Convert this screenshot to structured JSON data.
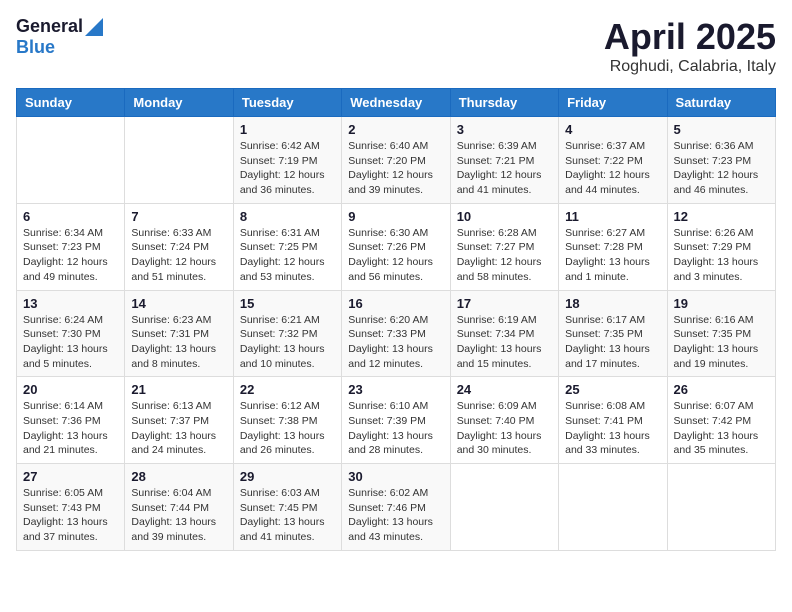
{
  "header": {
    "logo_general": "General",
    "logo_blue": "Blue",
    "month_title": "April 2025",
    "location": "Roghudi, Calabria, Italy"
  },
  "weekdays": [
    "Sunday",
    "Monday",
    "Tuesday",
    "Wednesday",
    "Thursday",
    "Friday",
    "Saturday"
  ],
  "weeks": [
    [
      {
        "day": "",
        "info": ""
      },
      {
        "day": "",
        "info": ""
      },
      {
        "day": "1",
        "info": "Sunrise: 6:42 AM\nSunset: 7:19 PM\nDaylight: 12 hours\nand 36 minutes."
      },
      {
        "day": "2",
        "info": "Sunrise: 6:40 AM\nSunset: 7:20 PM\nDaylight: 12 hours\nand 39 minutes."
      },
      {
        "day": "3",
        "info": "Sunrise: 6:39 AM\nSunset: 7:21 PM\nDaylight: 12 hours\nand 41 minutes."
      },
      {
        "day": "4",
        "info": "Sunrise: 6:37 AM\nSunset: 7:22 PM\nDaylight: 12 hours\nand 44 minutes."
      },
      {
        "day": "5",
        "info": "Sunrise: 6:36 AM\nSunset: 7:23 PM\nDaylight: 12 hours\nand 46 minutes."
      }
    ],
    [
      {
        "day": "6",
        "info": "Sunrise: 6:34 AM\nSunset: 7:23 PM\nDaylight: 12 hours\nand 49 minutes."
      },
      {
        "day": "7",
        "info": "Sunrise: 6:33 AM\nSunset: 7:24 PM\nDaylight: 12 hours\nand 51 minutes."
      },
      {
        "day": "8",
        "info": "Sunrise: 6:31 AM\nSunset: 7:25 PM\nDaylight: 12 hours\nand 53 minutes."
      },
      {
        "day": "9",
        "info": "Sunrise: 6:30 AM\nSunset: 7:26 PM\nDaylight: 12 hours\nand 56 minutes."
      },
      {
        "day": "10",
        "info": "Sunrise: 6:28 AM\nSunset: 7:27 PM\nDaylight: 12 hours\nand 58 minutes."
      },
      {
        "day": "11",
        "info": "Sunrise: 6:27 AM\nSunset: 7:28 PM\nDaylight: 13 hours\nand 1 minute."
      },
      {
        "day": "12",
        "info": "Sunrise: 6:26 AM\nSunset: 7:29 PM\nDaylight: 13 hours\nand 3 minutes."
      }
    ],
    [
      {
        "day": "13",
        "info": "Sunrise: 6:24 AM\nSunset: 7:30 PM\nDaylight: 13 hours\nand 5 minutes."
      },
      {
        "day": "14",
        "info": "Sunrise: 6:23 AM\nSunset: 7:31 PM\nDaylight: 13 hours\nand 8 minutes."
      },
      {
        "day": "15",
        "info": "Sunrise: 6:21 AM\nSunset: 7:32 PM\nDaylight: 13 hours\nand 10 minutes."
      },
      {
        "day": "16",
        "info": "Sunrise: 6:20 AM\nSunset: 7:33 PM\nDaylight: 13 hours\nand 12 minutes."
      },
      {
        "day": "17",
        "info": "Sunrise: 6:19 AM\nSunset: 7:34 PM\nDaylight: 13 hours\nand 15 minutes."
      },
      {
        "day": "18",
        "info": "Sunrise: 6:17 AM\nSunset: 7:35 PM\nDaylight: 13 hours\nand 17 minutes."
      },
      {
        "day": "19",
        "info": "Sunrise: 6:16 AM\nSunset: 7:35 PM\nDaylight: 13 hours\nand 19 minutes."
      }
    ],
    [
      {
        "day": "20",
        "info": "Sunrise: 6:14 AM\nSunset: 7:36 PM\nDaylight: 13 hours\nand 21 minutes."
      },
      {
        "day": "21",
        "info": "Sunrise: 6:13 AM\nSunset: 7:37 PM\nDaylight: 13 hours\nand 24 minutes."
      },
      {
        "day": "22",
        "info": "Sunrise: 6:12 AM\nSunset: 7:38 PM\nDaylight: 13 hours\nand 26 minutes."
      },
      {
        "day": "23",
        "info": "Sunrise: 6:10 AM\nSunset: 7:39 PM\nDaylight: 13 hours\nand 28 minutes."
      },
      {
        "day": "24",
        "info": "Sunrise: 6:09 AM\nSunset: 7:40 PM\nDaylight: 13 hours\nand 30 minutes."
      },
      {
        "day": "25",
        "info": "Sunrise: 6:08 AM\nSunset: 7:41 PM\nDaylight: 13 hours\nand 33 minutes."
      },
      {
        "day": "26",
        "info": "Sunrise: 6:07 AM\nSunset: 7:42 PM\nDaylight: 13 hours\nand 35 minutes."
      }
    ],
    [
      {
        "day": "27",
        "info": "Sunrise: 6:05 AM\nSunset: 7:43 PM\nDaylight: 13 hours\nand 37 minutes."
      },
      {
        "day": "28",
        "info": "Sunrise: 6:04 AM\nSunset: 7:44 PM\nDaylight: 13 hours\nand 39 minutes."
      },
      {
        "day": "29",
        "info": "Sunrise: 6:03 AM\nSunset: 7:45 PM\nDaylight: 13 hours\nand 41 minutes."
      },
      {
        "day": "30",
        "info": "Sunrise: 6:02 AM\nSunset: 7:46 PM\nDaylight: 13 hours\nand 43 minutes."
      },
      {
        "day": "",
        "info": ""
      },
      {
        "day": "",
        "info": ""
      },
      {
        "day": "",
        "info": ""
      }
    ]
  ]
}
